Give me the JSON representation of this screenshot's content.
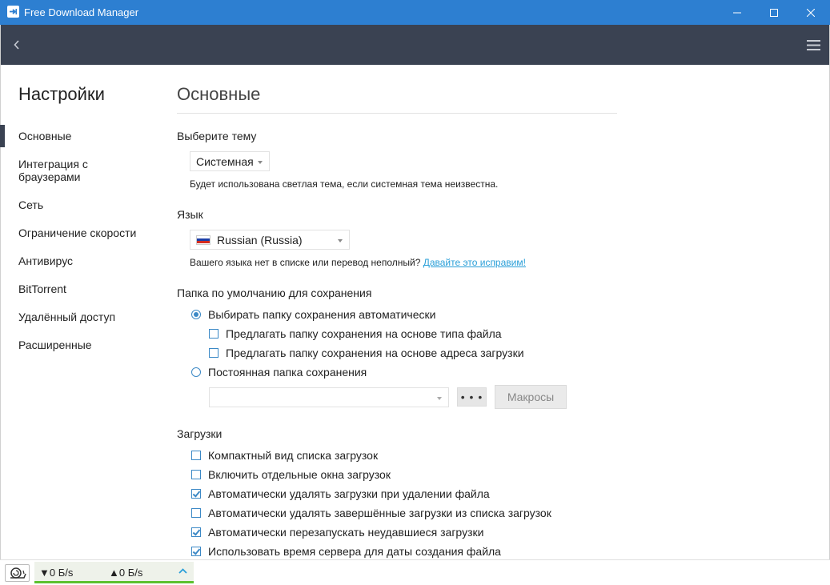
{
  "window": {
    "title": "Free Download Manager",
    "colors": {
      "titlebar": "#2d7fd1",
      "toolbar": "#3a4252",
      "accent": "#3c89c6",
      "speed_bar": "#5cc12f"
    }
  },
  "toolbar": {
    "back_icon": "chevron-left-icon",
    "menu_icon": "hamburger-menu-icon"
  },
  "sidebar": {
    "heading": "Настройки",
    "items": [
      {
        "label": "Основные",
        "selected": true
      },
      {
        "label": "Интеграция с браузерами",
        "line1": "Интеграция с",
        "line2": "браузерами"
      },
      {
        "label": "Сеть"
      },
      {
        "label": "Ограничение скорости"
      },
      {
        "label": "Антивирус"
      },
      {
        "label": "BitTorrent"
      },
      {
        "label": "Удалённый доступ"
      },
      {
        "label": "Расширенные"
      }
    ]
  },
  "main": {
    "heading": "Основные",
    "theme": {
      "label": "Выберите тему",
      "selected": "Системная",
      "note": "Будет использована светлая тема, если системная тема неизвестна."
    },
    "language": {
      "label": "Язык",
      "selected": "Russian (Russia)",
      "flag_colors": [
        "#ffffff",
        "#1c3fa8",
        "#d52b1e"
      ],
      "note": "Вашего языка нет в списке или перевод неполный?",
      "note_link": "Давайте это исправим!"
    },
    "save_folder": {
      "label": "Папка по умолчанию для сохранения",
      "auto_option": {
        "label": "Выбирать папку сохранения автоматически",
        "checked": true
      },
      "by_type": {
        "label": "Предлагать папку сохранения на основе типа файла",
        "checked": false
      },
      "by_address": {
        "label": "Предлагать папку сохранения на основе адреса загрузки",
        "checked": false
      },
      "fixed_option": {
        "label": "Постоянная папка сохранения",
        "checked": false
      },
      "path_value": "",
      "browse_label": "• • •",
      "macros_label": "Макросы"
    },
    "downloads": {
      "label": "Загрузки",
      "options": [
        {
          "label": "Компактный вид списка загрузок",
          "checked": false
        },
        {
          "label": "Включить отдельные окна загрузок",
          "checked": false
        },
        {
          "label": "Автоматически удалять загрузки при удалении файла",
          "checked": true
        },
        {
          "label": "Автоматически удалять завершённые загрузки из списка загрузок",
          "checked": false
        },
        {
          "label": "Автоматически перезапускать неудавшиеся загрузки",
          "checked": true
        },
        {
          "label": "Использовать время сервера для даты создания файла",
          "checked": true
        }
      ]
    }
  },
  "statusbar": {
    "snail_icon": "snail-icon",
    "download_speed": "▼0 Б/s",
    "upload_speed": "▲0 Б/s"
  }
}
